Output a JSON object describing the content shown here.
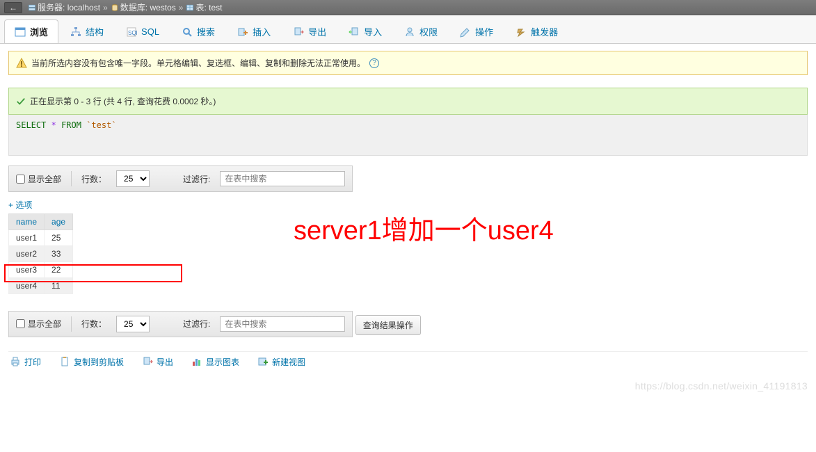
{
  "breadcrumb": {
    "back": "←",
    "server_label": "服务器:",
    "server_value": "localhost",
    "db_label": "数据库:",
    "db_value": "westos",
    "table_label": "表:",
    "table_value": "test"
  },
  "tabs": {
    "browse": "浏览",
    "structure": "结构",
    "sql": "SQL",
    "search": "搜索",
    "insert": "插入",
    "export": "导出",
    "import": "导入",
    "privileges": "权限",
    "operations": "操作",
    "triggers": "触发器"
  },
  "notice": {
    "text": "当前所选内容没有包含唯一字段。单元格编辑、复选框、编辑、复制和删除无法正常使用。"
  },
  "success": {
    "text": "正在显示第 0 - 3 行 (共 4 行, 查询花费 0.0002 秒。)"
  },
  "sql": {
    "select": "SELECT",
    "star": "*",
    "from": "FROM",
    "table": "`test`"
  },
  "controls": {
    "show_all": "显示全部",
    "rows_label": "行数：",
    "rows_value": "25",
    "filter_label": "过滤行:",
    "filter_placeholder": "在表中搜索"
  },
  "options_link": "+ 选项",
  "table": {
    "headers": {
      "name": "name",
      "age": "age"
    },
    "rows": [
      {
        "name": "user1",
        "age": "25"
      },
      {
        "name": "user2",
        "age": "33"
      },
      {
        "name": "user3",
        "age": "22"
      },
      {
        "name": "user4",
        "age": "11"
      }
    ]
  },
  "annotation": "server1增加一个user4",
  "result_ops_label": "查询结果操作",
  "actions": {
    "print": "打印",
    "copy": "复制到剪贴板",
    "export": "导出",
    "chart": "显示图表",
    "view": "新建视图"
  },
  "watermark": "https://blog.csdn.net/weixin_41191813"
}
